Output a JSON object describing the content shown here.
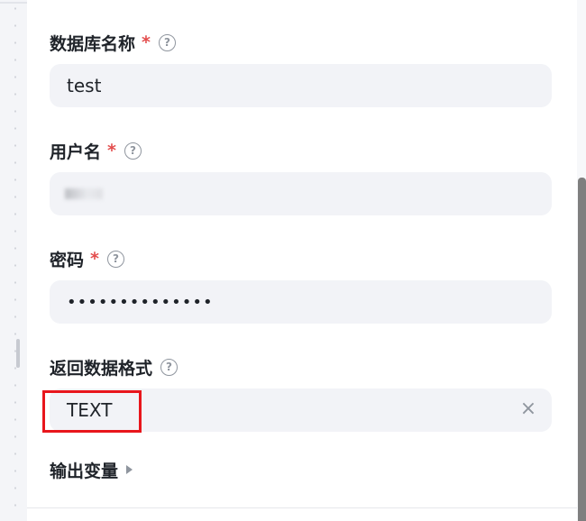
{
  "form": {
    "db_name": {
      "label": "数据库名称",
      "required_mark": "*",
      "help_glyph": "?",
      "value": "test"
    },
    "username": {
      "label": "用户名",
      "required_mark": "*",
      "help_glyph": "?",
      "value": ""
    },
    "password": {
      "label": "密码",
      "required_mark": "*",
      "help_glyph": "?",
      "value": "••••••••••••••"
    },
    "return_format": {
      "label": "返回数据格式",
      "help_glyph": "?",
      "value": "TEXT",
      "clear_glyph": "×"
    },
    "output_vars": {
      "label": "输出变量"
    }
  },
  "colors": {
    "required": "#e34d4d",
    "highlight": "#e8161c",
    "input_bg": "#f2f3f7"
  }
}
